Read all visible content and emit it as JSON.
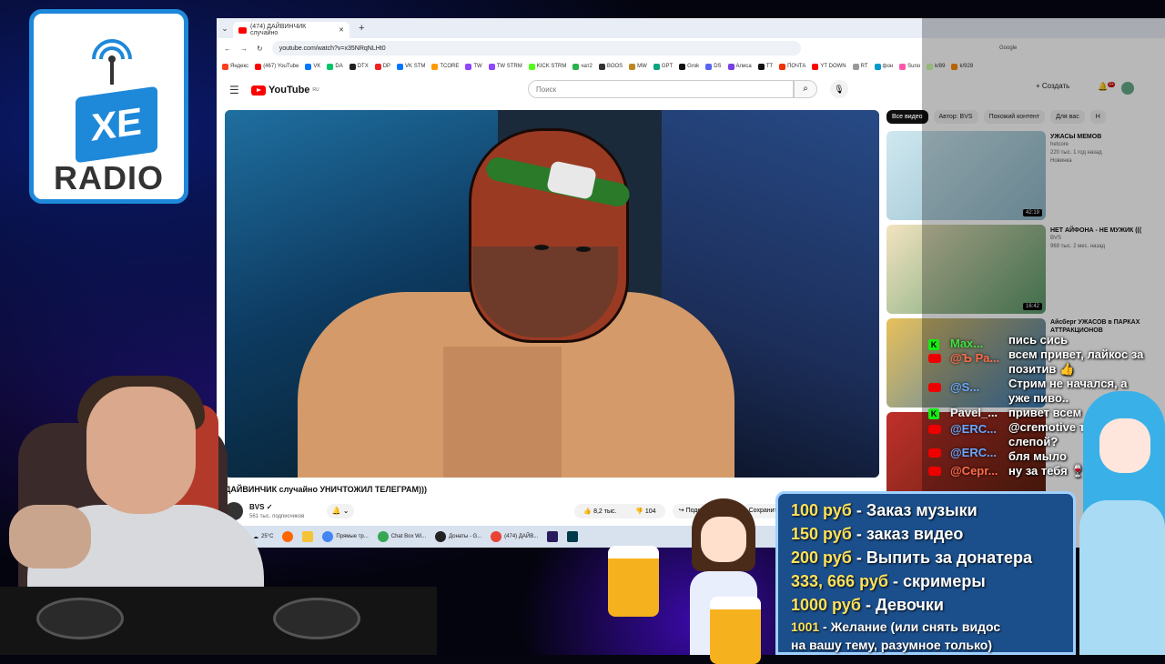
{
  "logo": {
    "badge": "XE",
    "text": "RADIO"
  },
  "browser": {
    "tab_title": "(474) ДАЙВИНЧИК случайно",
    "url": "youtube.com/watch?v=x35NRqNLHt0",
    "search_engine": "Google",
    "bookmarks": [
      "Яндекс",
      "(467) YouTube",
      "VK",
      "DA",
      "DTX",
      "DP",
      "VK STM",
      "TCORE",
      "TW",
      "TW STRM",
      "KICK STRM",
      "чат2",
      "BOOS",
      "MW",
      "GPT",
      "Grok",
      "DS",
      "Алиса",
      "TT",
      "ПОЧТА",
      "YT DOWN",
      "RT",
      "фон",
      "Suno",
      "k/89",
      "k/928"
    ]
  },
  "youtube": {
    "logo_text": "YouTube",
    "region": "RU",
    "search_placeholder": "Поиск",
    "create_label": "Создать",
    "notif_count": "9+",
    "video_title": "ДАЙВИНЧИК случайно УНИЧТОЖИЛ ТЕЛЕГРАМ)))",
    "channel_name": "BVS",
    "channel_subs": "561 тыс. подписчиков",
    "likes": "8,2 тыс.",
    "dislikes": "104",
    "share_label": "Поделиться",
    "save_label": "Сохранить",
    "chips": [
      "Все видео",
      "Автор: BVS",
      "Похожий контент",
      "Для вас",
      "Н"
    ],
    "recs": [
      {
        "title": "УЖАСЫ МЕМОВ",
        "channel": "hetcore",
        "meta": "220 тыс. 1 год назад",
        "badge": "Новинка",
        "duration": "42:19"
      },
      {
        "title": "НЕТ АЙФОНА - НЕ МУЖИК (((",
        "channel": "BVS",
        "meta": "969 тыс. 2 мес. назад",
        "badge": "",
        "duration": "16:42"
      },
      {
        "title": "Айсберг УЖАСОВ в ПАРКАХ АТТРАКЦИОНОВ",
        "channel": "",
        "meta": "",
        "badge": "",
        "duration": ""
      },
      {
        "title": "",
        "channel": "",
        "meta": "",
        "badge": "",
        "duration": ""
      }
    ]
  },
  "taskbar": {
    "weather": "25°C",
    "items": [
      "Прямые тр...",
      "Chat Box Wi...",
      "Донаты - G...",
      "(474) ДАЙВ..."
    ]
  },
  "chat": {
    "users": [
      {
        "name": "Max...",
        "platform": "kick",
        "color": "#40e040"
      },
      {
        "name": "@Ъ Ра...",
        "platform": "youtube",
        "color": "#ff6b4a"
      },
      {
        "name": "@S...",
        "platform": "youtube",
        "color": "#6aa8ff"
      },
      {
        "name": "Pavel_...",
        "platform": "kick",
        "color": "#f0f0f0"
      },
      {
        "name": "@ERC...",
        "platform": "youtube",
        "color": "#6aa8ff"
      },
      {
        "name": "@ERC...",
        "platform": "youtube",
        "color": "#6aa8ff"
      },
      {
        "name": "@Cepr...",
        "platform": "youtube",
        "color": "#ff6b4a"
      }
    ],
    "messages": [
      "пись сись",
      "всем привет, лайкос за",
      "позитив 👍",
      "Стрим не начался, а",
      "уже пиво..",
      "привет всем",
      "@cremotive ты",
      "слепой?",
      "бля мыло",
      "ну за тебя 🍷"
    ]
  },
  "donations": [
    {
      "price": "100 руб",
      "label": "Заказ музыки"
    },
    {
      "price": "150 руб",
      "label": "заказ видео"
    },
    {
      "price": "200 руб",
      "label": "Выпить за донатера"
    },
    {
      "price": "333, 666 руб",
      "label": "скримеры"
    },
    {
      "price": "1000 руб",
      "label": "Девочки"
    },
    {
      "price": "1001",
      "label": "Желание (или снять видос"
    },
    {
      "price": "",
      "label": "на вашу тему, разумное только)"
    }
  ],
  "colors": {
    "accent": "#1e88d9",
    "youtube_red": "#ff0000",
    "donate_bg": "#1b4f8c",
    "price": "#ffe15a"
  }
}
